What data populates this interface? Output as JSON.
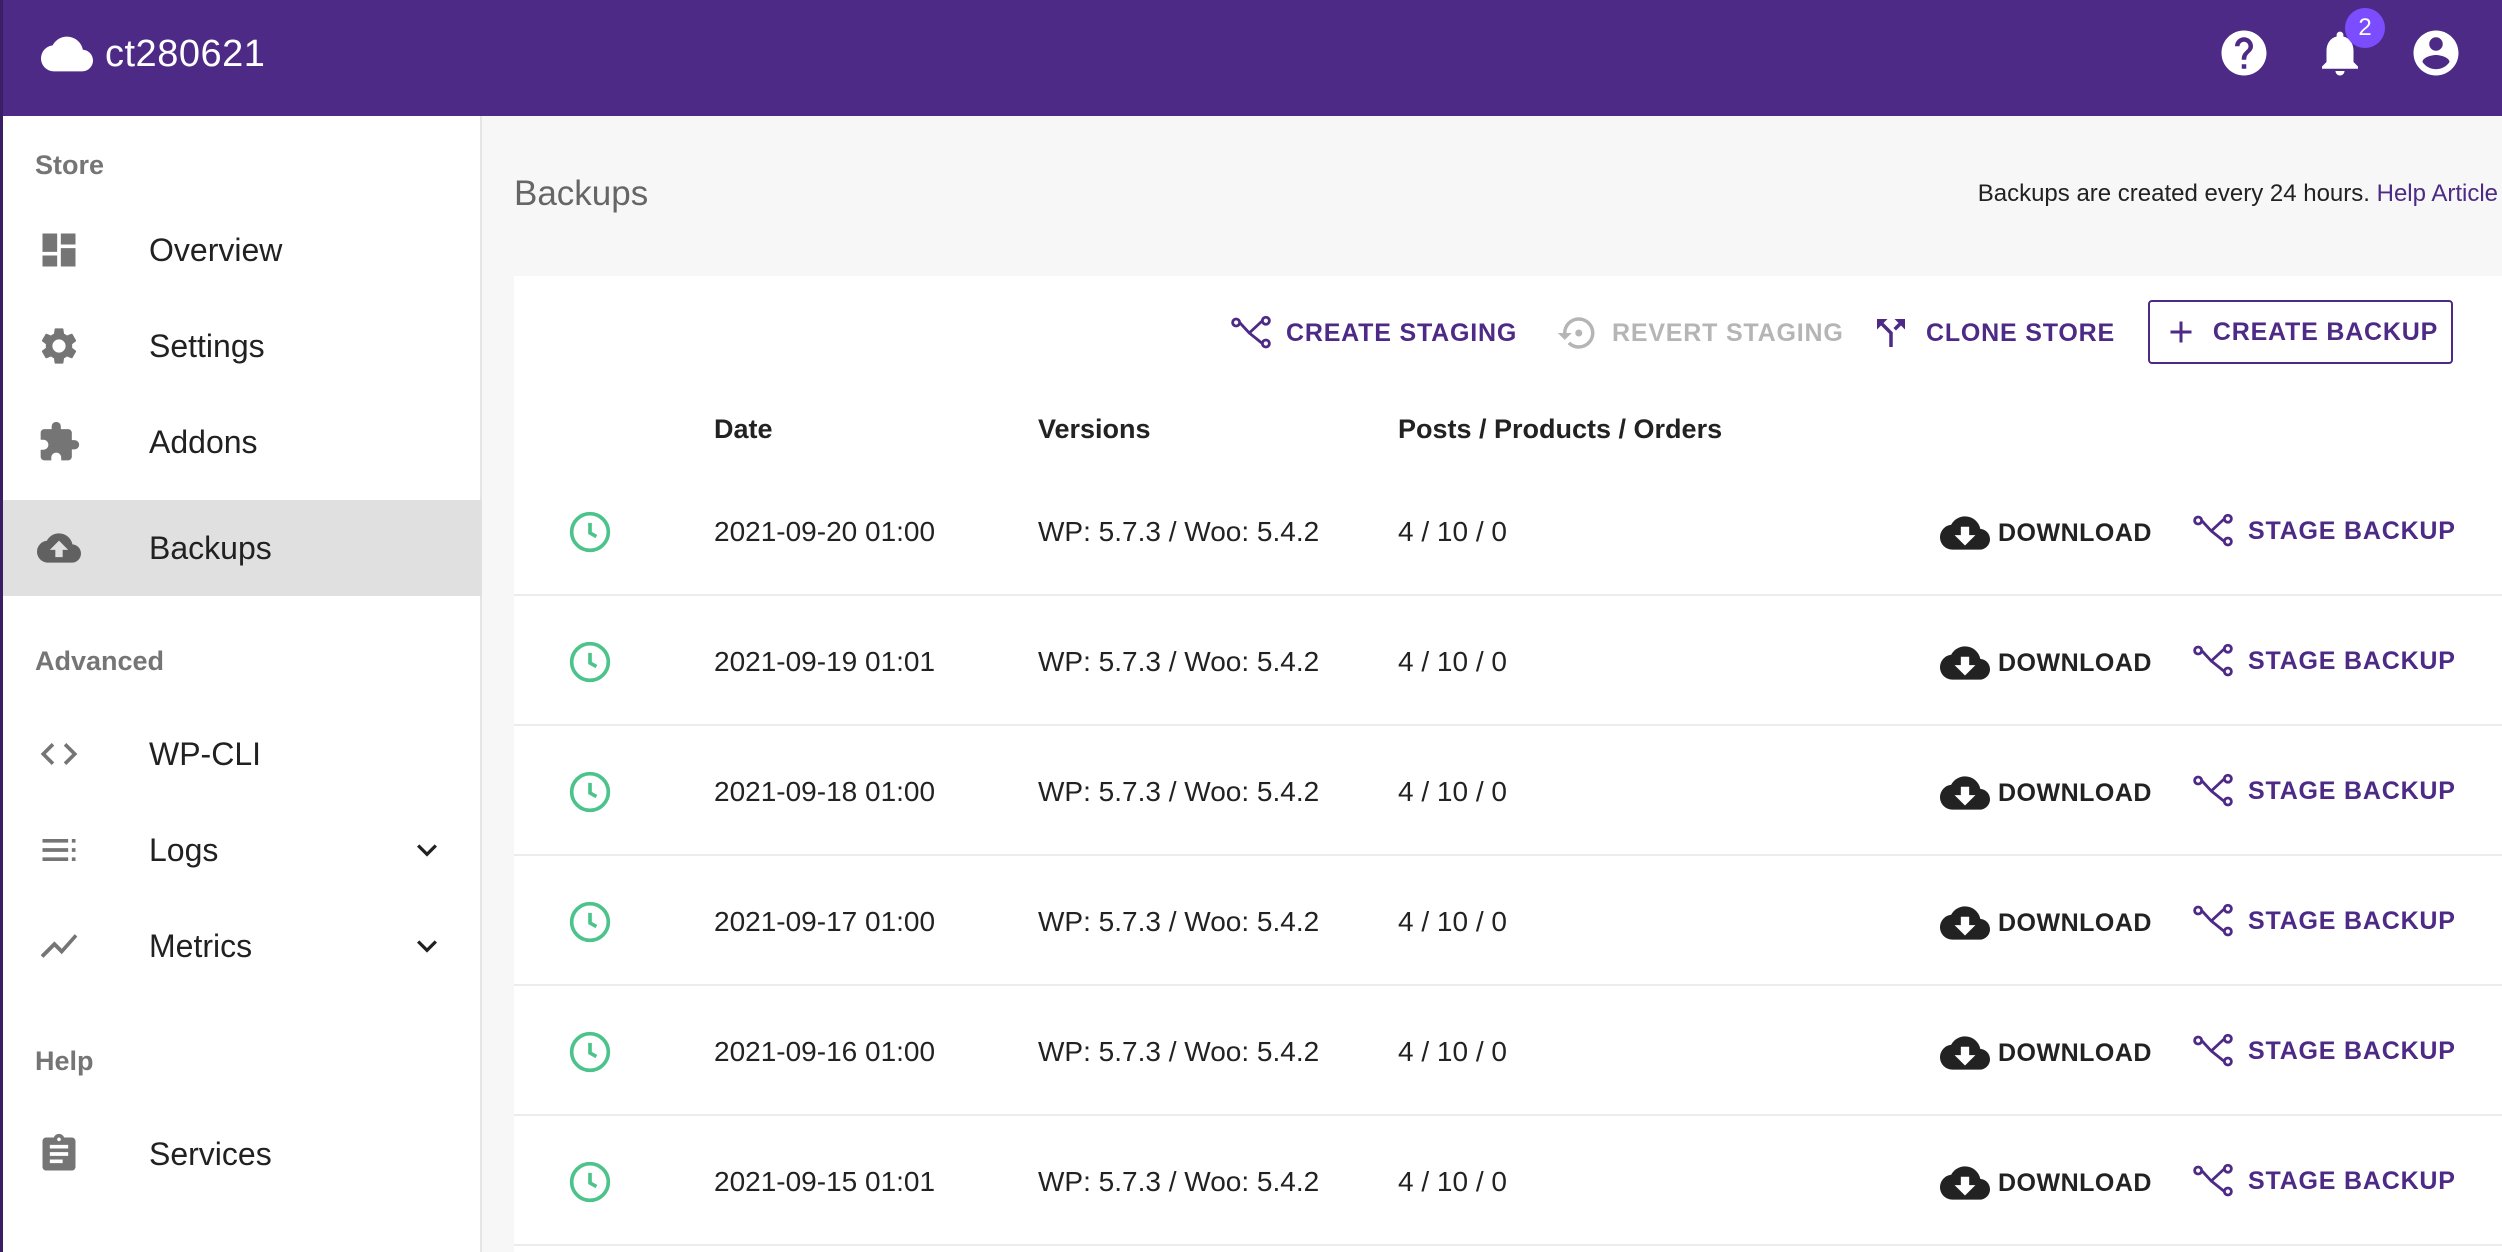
{
  "header": {
    "store_name": "ct280621",
    "notification_count": "2",
    "icons": [
      "cloud-icon",
      "help-icon",
      "bell-icon",
      "account-icon"
    ]
  },
  "sidebar": {
    "sections": {
      "store": "Store",
      "advanced": "Advanced",
      "help": "Help"
    },
    "items": [
      {
        "label": "Overview",
        "icon": "dashboard-icon"
      },
      {
        "label": "Settings",
        "icon": "gear-icon"
      },
      {
        "label": "Addons",
        "icon": "puzzle-icon"
      },
      {
        "label": "Backups",
        "icon": "cloud-upload-icon",
        "active": true
      },
      {
        "label": "WP-CLI",
        "icon": "code-icon"
      },
      {
        "label": "Logs",
        "icon": "list-icon"
      },
      {
        "label": "Metrics",
        "icon": "trending-icon"
      },
      {
        "label": "Services",
        "icon": "clipboard-icon"
      }
    ]
  },
  "main": {
    "title": "Backups",
    "info_text": "Backups are created every 24 hours.",
    "help_link": "Help Article",
    "actions": {
      "create_staging": "CREATE STAGING",
      "revert_staging": "REVERT STAGING",
      "clone_store": "CLONE STORE",
      "create_backup": "CREATE BACKUP"
    },
    "columns": {
      "date": "Date",
      "versions": "Versions",
      "counts": "Posts / Products / Orders"
    },
    "row_actions": {
      "download": "DOWNLOAD",
      "stage": "STAGE BACKUP"
    },
    "rows": [
      {
        "date": "2021-09-20 01:00",
        "versions": "WP: 5.7.3 / Woo: 5.4.2",
        "counts": "4 / 10 / 0"
      },
      {
        "date": "2021-09-19 01:01",
        "versions": "WP: 5.7.3 / Woo: 5.4.2",
        "counts": "4 / 10 / 0"
      },
      {
        "date": "2021-09-18 01:00",
        "versions": "WP: 5.7.3 / Woo: 5.4.2",
        "counts": "4 / 10 / 0"
      },
      {
        "date": "2021-09-17 01:00",
        "versions": "WP: 5.7.3 / Woo: 5.4.2",
        "counts": "4 / 10 / 0"
      },
      {
        "date": "2021-09-16 01:00",
        "versions": "WP: 5.7.3 / Woo: 5.4.2",
        "counts": "4 / 10 / 0"
      },
      {
        "date": "2021-09-15 01:01",
        "versions": "WP: 5.7.3 / Woo: 5.4.2",
        "counts": "4 / 10 / 0"
      }
    ]
  },
  "colors": {
    "primary": "#4d2a86",
    "badge": "#7c4dff",
    "clock": "#4cc38a",
    "disabled": "#b5b5b5"
  }
}
